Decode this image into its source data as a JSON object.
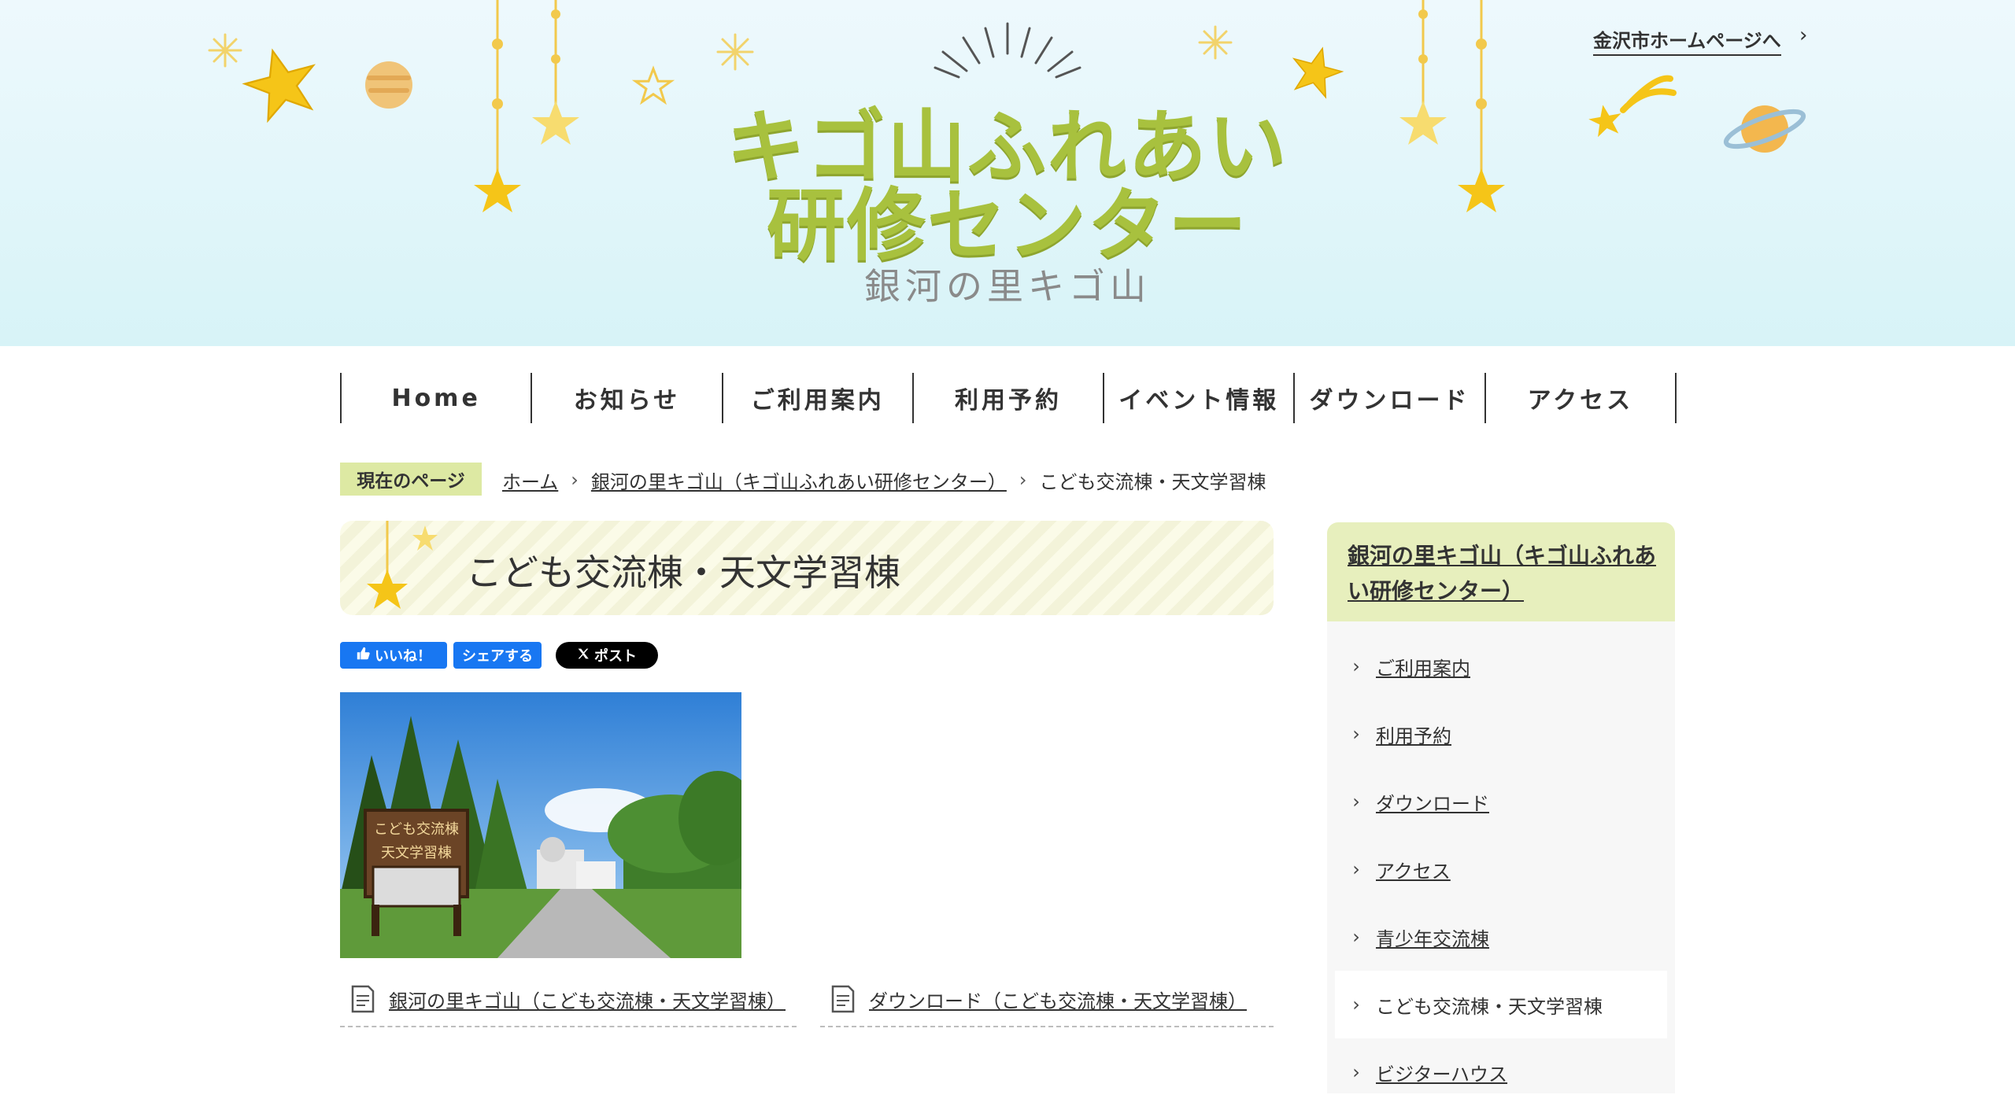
{
  "header": {
    "logo_line1": "キゴ山ふれあい",
    "logo_line2": "研修センター",
    "logo_sub": "銀河の里キゴ山",
    "city_link": "金沢市ホームページへ"
  },
  "nav": {
    "items": [
      {
        "label": "Home"
      },
      {
        "label": "お知らせ"
      },
      {
        "label": "ご利用案内"
      },
      {
        "label": "利用予約"
      },
      {
        "label": "イベント情報"
      },
      {
        "label": "ダウンロード"
      },
      {
        "label": "アクセス"
      }
    ]
  },
  "breadcrumb": {
    "label": "現在のページ",
    "items": [
      {
        "label": "ホーム"
      },
      {
        "label": "銀河の里キゴ山（キゴ山ふれあい研修センター）"
      },
      {
        "label": "こども交流棟・天文学習棟"
      }
    ]
  },
  "page": {
    "title": "こども交流棟・天文学習棟"
  },
  "sns": {
    "like": "いいね！",
    "share": "シェアする",
    "post": "ポスト"
  },
  "photo": {
    "sign_line1": "こども交流棟",
    "sign_line2": "天文学習棟"
  },
  "links": [
    {
      "label": "銀河の里キゴ山（こども交流棟・天文学習棟）"
    },
    {
      "label": "ダウンロード（こども交流棟・天文学習棟）"
    }
  ],
  "sidebar": {
    "title": "銀河の里キゴ山（キゴ山ふれあい研修センター）",
    "items": [
      {
        "label": "ご利用案内"
      },
      {
        "label": "利用予約"
      },
      {
        "label": "ダウンロード"
      },
      {
        "label": "アクセス"
      },
      {
        "label": "青少年交流棟"
      },
      {
        "label": "こども交流棟・天文学習棟"
      },
      {
        "label": "ビジターハウス"
      }
    ]
  }
}
